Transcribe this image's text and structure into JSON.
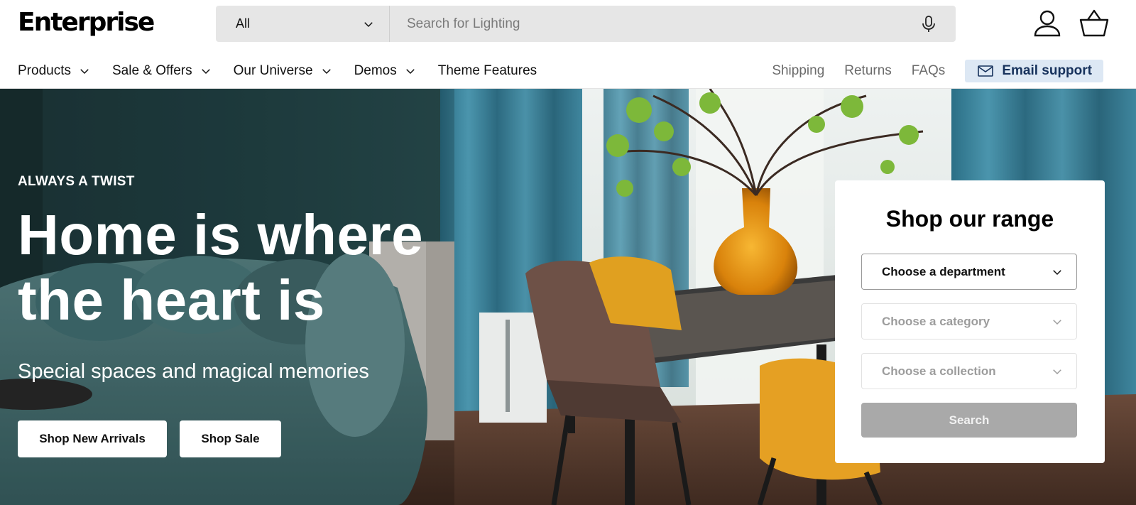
{
  "brand": {
    "logo_text": "Enterprise"
  },
  "search": {
    "category_label": "All",
    "placeholder": "Search for Lighting",
    "value": ""
  },
  "nav": {
    "items": [
      {
        "label": "Products",
        "has_dropdown": true
      },
      {
        "label": "Sale & Offers",
        "has_dropdown": true
      },
      {
        "label": "Our Universe",
        "has_dropdown": true
      },
      {
        "label": "Demos",
        "has_dropdown": true
      },
      {
        "label": "Theme Features",
        "has_dropdown": false
      }
    ]
  },
  "utility": {
    "shipping": "Shipping",
    "returns": "Returns",
    "faqs": "FAQs",
    "email_support": "Email support"
  },
  "icons": {
    "search_category_chevron": "chevron-down-icon",
    "mic": "microphone-icon",
    "account": "user-icon",
    "cart": "basket-icon",
    "email": "envelope-icon"
  },
  "hero": {
    "eyebrow": "ALWAYS A TWIST",
    "headline": "Home is where the heart is",
    "subline": "Special spaces and magical memories",
    "buttons": {
      "new_arrivals": "Shop New Arrivals",
      "sale": "Shop Sale"
    }
  },
  "shop_panel": {
    "title": "Shop our range",
    "department_placeholder": "Choose a department",
    "category_placeholder": "Choose a category",
    "collection_placeholder": "Choose a collection",
    "search_button": "Search"
  },
  "colors": {
    "search_bg": "#e6e6e6",
    "email_btn_bg": "#dde8f4",
    "email_btn_text": "#17325c",
    "panel_search_btn": "#a9a9a9",
    "hero_text": "#ffffff"
  }
}
